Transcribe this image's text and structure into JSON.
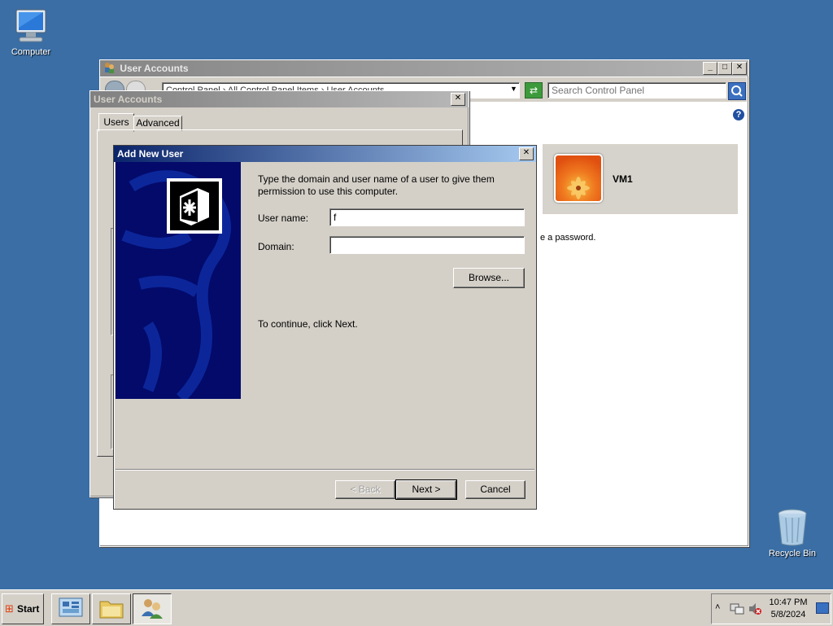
{
  "desktop": {
    "computer_label": "Computer",
    "recycle_label": "Recycle Bin"
  },
  "control_panel": {
    "title": "User Accounts",
    "address": "Control Panel › All Control Panel Items › User Accounts",
    "search_placeholder": "Search Control Panel",
    "account_name": "VM1",
    "password_text": "e a password."
  },
  "ua_dialog": {
    "title": "User Accounts",
    "tabs": [
      "Users",
      "Advanced"
    ]
  },
  "wizard": {
    "title": "Add New User",
    "instructions": "Type the domain and user name of a user to give them permission to use this computer.",
    "username_label": "User name:",
    "username_value": "f",
    "domain_label": "Domain:",
    "domain_value": "",
    "browse_label": "Browse...",
    "continue_text": "To continue, click Next.",
    "back_label": "< Back",
    "next_label": "Next >",
    "cancel_label": "Cancel"
  },
  "taskbar": {
    "start_label": "Start",
    "time": "10:47 PM",
    "date": "5/8/2024"
  },
  "icons": {
    "help": "help-icon",
    "search": "search-icon",
    "refresh": "refresh-icon"
  }
}
